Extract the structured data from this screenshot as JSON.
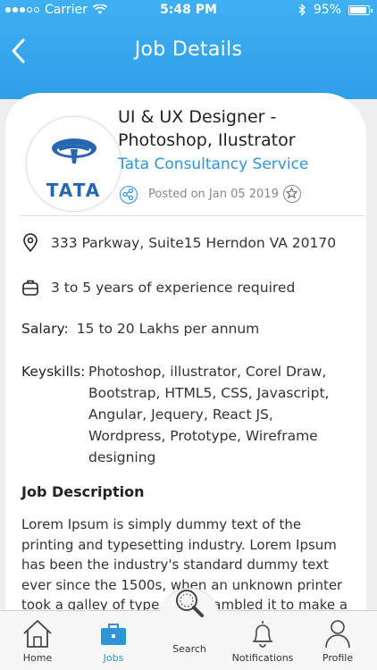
{
  "status_bar": {
    "carrier": "Carrier",
    "time": "5:48 PM",
    "battery": "95%",
    "signal_bars": 3
  },
  "header": {
    "title": "Job Details"
  },
  "job": {
    "title": "UI & UX Designer - Photoshop, Ilustrator",
    "company": "Tata Consultancy Service",
    "logo_text": "TATA",
    "posted": "Posted on Jan 05 2019",
    "address": "333 Parkway, Suite15 Herndon VA 20170",
    "experience": "3 to 5 years of experience required",
    "salary_label": "Salary:",
    "salary": "15 to 20 Lakhs per annum",
    "keyskills_label": "Keyskills:",
    "keyskills": "Photoshop, illustrator, Corel Draw, Bootstrap, HTML5, CSS, Javascript, Angular, Jequery, React JS, Wordpress, Prototype, Wireframe designing",
    "description_heading": "Job Description",
    "description": "Lorem Ipsum is simply dummy text of the printing and typesetting industry. Lorem Ipsum has been the industry's standard dummy text ever since the 1500s, when an unknown printer took a galley of type and scrambled it to make a type specimen book."
  },
  "tabs": {
    "home": "Home",
    "jobs": "Jobs",
    "search": "Search",
    "notifications": "Notifications",
    "profile": "Profile"
  },
  "colors": {
    "accent": "#2f94d6",
    "header": "#3aaaf0",
    "logo_blue": "#2767b2"
  }
}
